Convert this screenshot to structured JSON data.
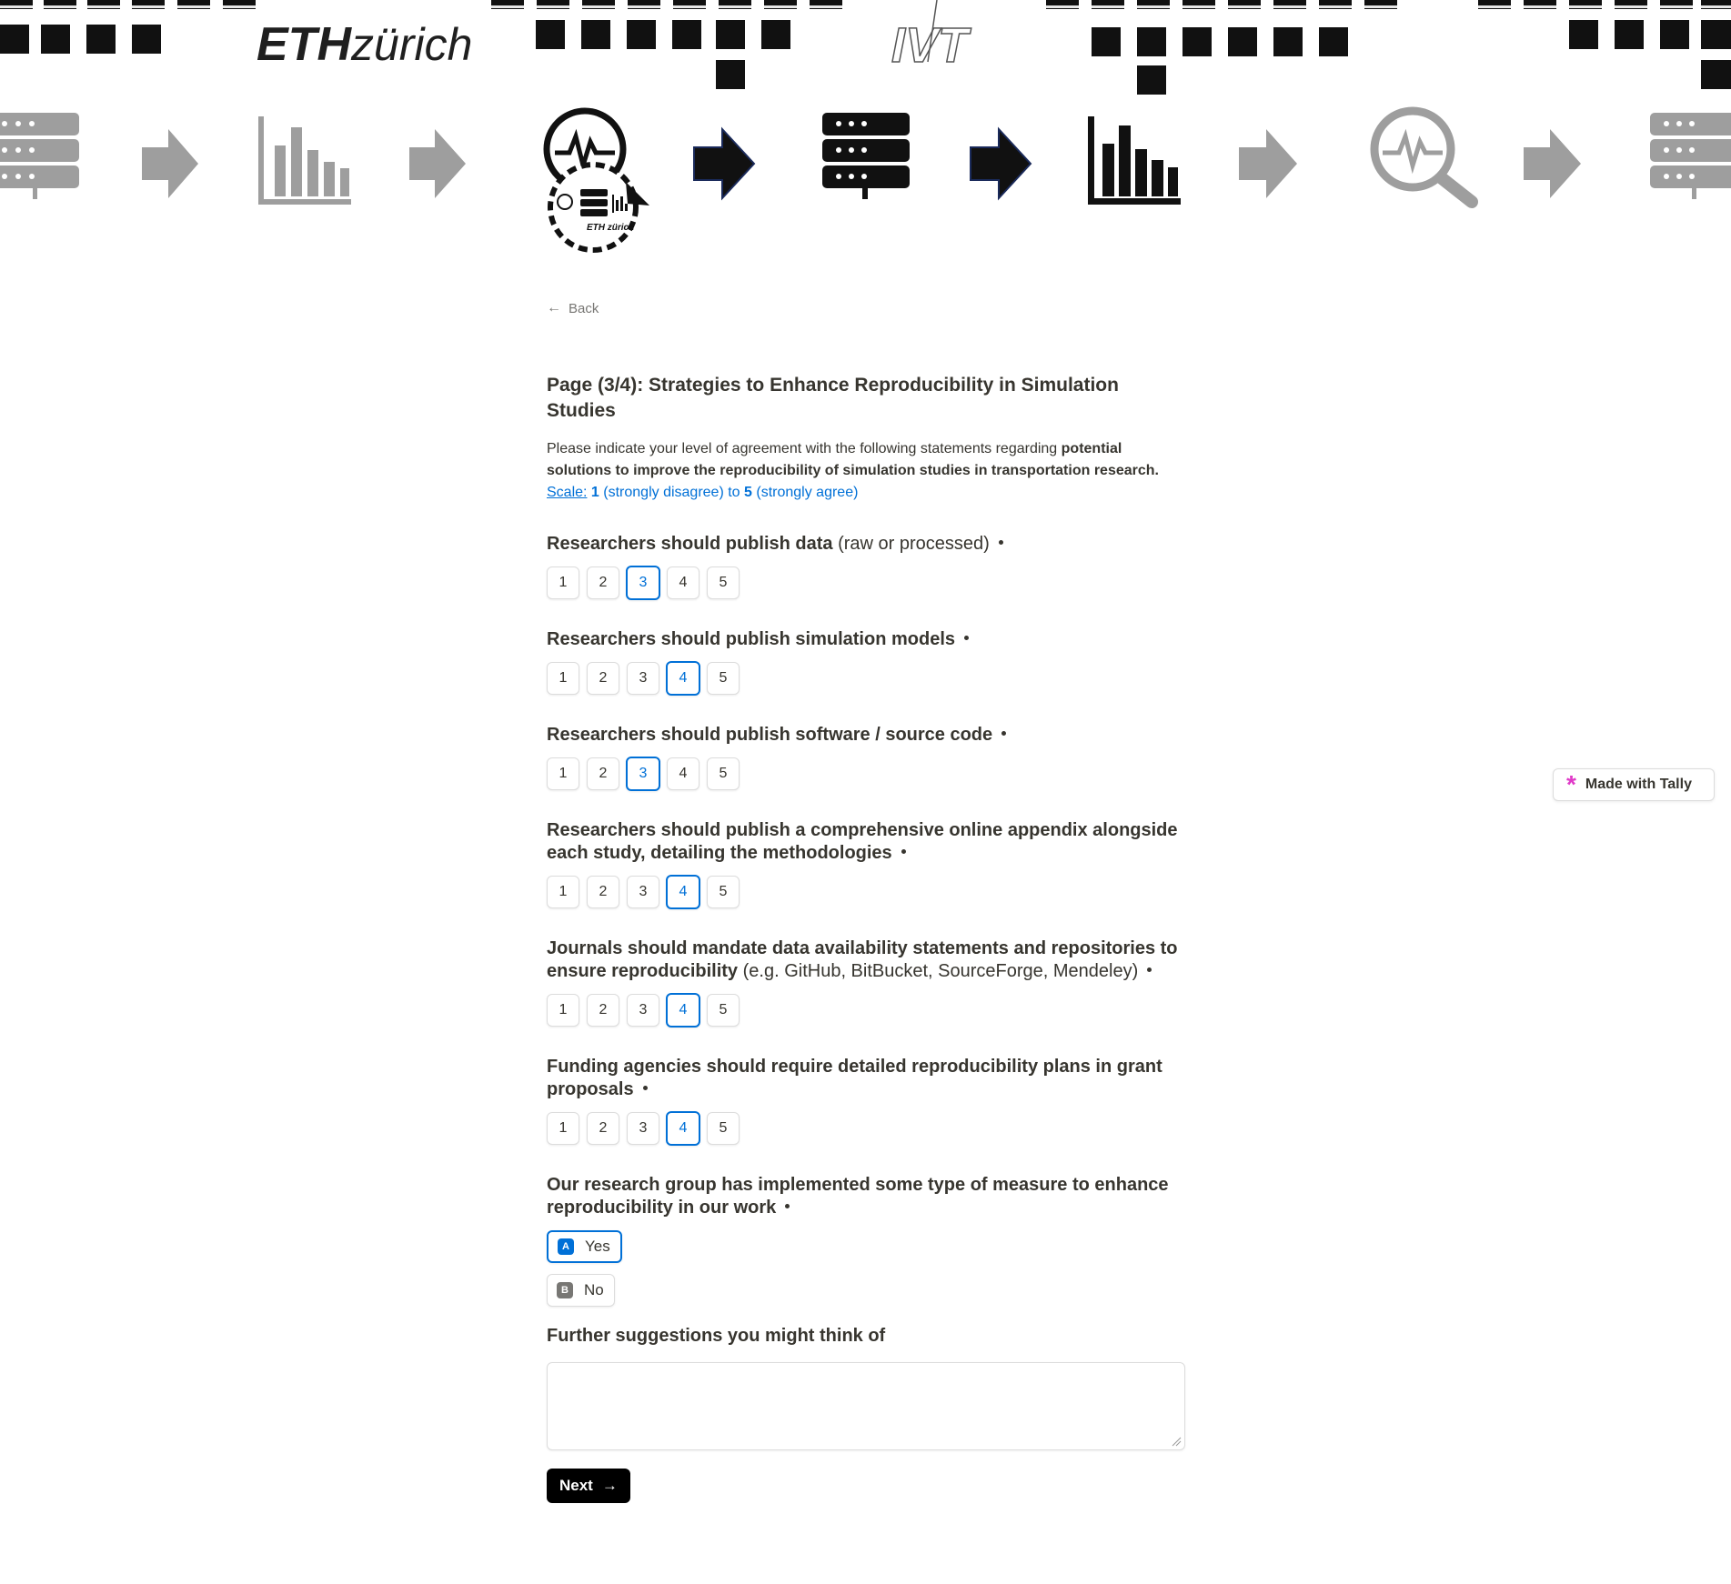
{
  "header": {
    "eth_logo_bold": "ETH",
    "eth_logo_light": "zürich",
    "ivt_logo": "IVT",
    "badge_eth_text": "ETH zürich"
  },
  "back_label": "Back",
  "page_title": "Page (3/4): Strategies to Enhance Reproducibility in Simulation Studies",
  "intro": {
    "text_plain": "Please indicate your level of agreement with the following statements regarding ",
    "text_bold": "potential solutions to improve the reproducibility of simulation studies in transportation research.",
    "scale_word": "Scale:",
    "scale_low": "1",
    "scale_low_label": " (strongly disagree) to ",
    "scale_high": "5",
    "scale_high_label": " (strongly agree)"
  },
  "scale_options": [
    "1",
    "2",
    "3",
    "4",
    "5"
  ],
  "questions": [
    {
      "title": "Researchers should publish data",
      "title_light": " (raw or processed)",
      "selected": 3
    },
    {
      "title": "Researchers should publish simulation models",
      "title_light": "",
      "selected": 4
    },
    {
      "title": "Researchers should publish software / source code",
      "title_light": "",
      "selected": 3
    },
    {
      "title": "Researchers should publish a comprehensive online appendix alongside each study, detailing the methodologies",
      "title_light": "",
      "selected": 4
    },
    {
      "title": "Journals should mandate data availability statements and repositories to ensure reproducibility",
      "title_light": " (e.g. GitHub, BitBucket, SourceForge, Mendeley)",
      "selected": 4
    },
    {
      "title": "Funding agencies should require detailed reproducibility plans in grant proposals",
      "title_light": "",
      "selected": 4
    }
  ],
  "implemented": {
    "title": "Our research group has implemented some type of measure to enhance reproducibility in our work",
    "options": [
      {
        "key": "A",
        "label": "Yes",
        "selected": true
      },
      {
        "key": "B",
        "label": "No",
        "selected": false
      }
    ]
  },
  "suggestions": {
    "title": "Further suggestions you might think of",
    "value": ""
  },
  "next_label": "Next",
  "tally_badge": "Made with Tally",
  "colors": {
    "accent": "#0070d7",
    "text": "#37352f",
    "muted": "#787774",
    "tally": "#e03ac8"
  }
}
